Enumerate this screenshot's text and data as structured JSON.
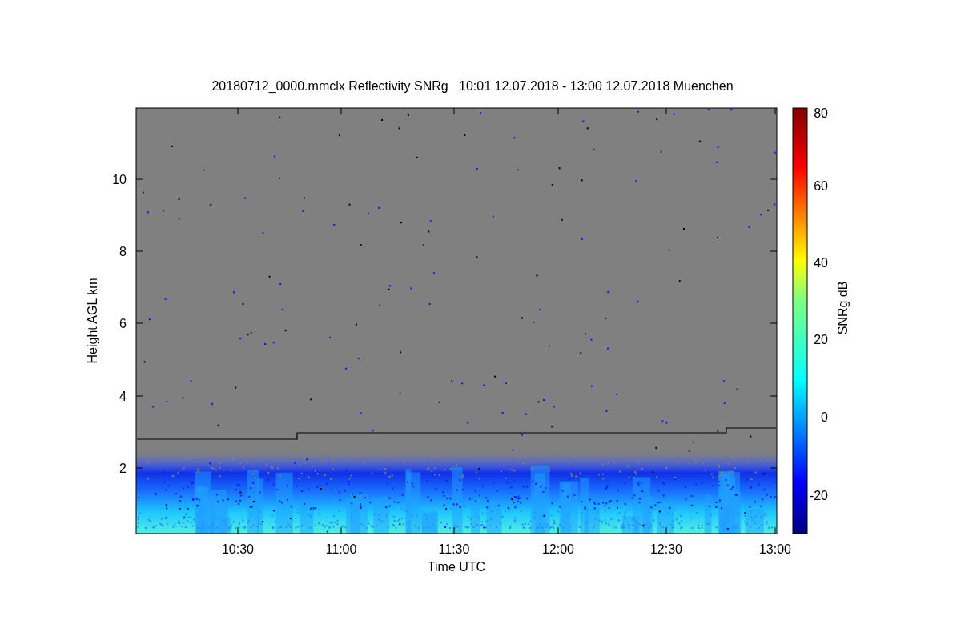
{
  "title": "20180712_0000.mmclx Reflectivity SNRg   10:01 12.07.2018 - 13:00 12.07.2018 Muenchen",
  "y_axis": {
    "label": "Height AGL km",
    "ticks": [
      "10",
      "8",
      "6",
      "4",
      "2"
    ]
  },
  "x_axis": {
    "label": "Time UTC",
    "ticks": [
      "10:30",
      "11:00",
      "11:30",
      "12:00",
      "12:30",
      "13:00"
    ]
  },
  "colorbar": {
    "label": "SNRg dB",
    "ticks": [
      "80",
      "60",
      "40",
      "20",
      "0",
      "-20"
    ]
  }
}
